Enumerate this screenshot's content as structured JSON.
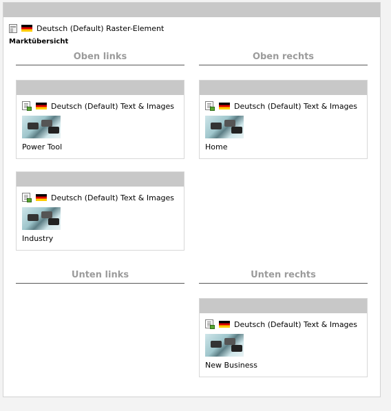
{
  "raster": {
    "language": "Deutsch (Default)",
    "label": "Deutsch (Default) Raster-Element",
    "title": "Marktübersicht"
  },
  "columns": {
    "oben_links": "Oben links",
    "oben_rechts": "Oben rechts",
    "unten_links": "Unten links",
    "unten_rechts": "Unten rechts"
  },
  "cards": [
    {
      "type_label": "Deutsch (Default) Text & Images",
      "caption": "Power Tool"
    },
    {
      "type_label": "Deutsch (Default) Text & Images",
      "caption": "Home"
    },
    {
      "type_label": "Deutsch (Default) Text & Images",
      "caption": "Industry"
    },
    {
      "type_label": "Deutsch (Default) Text & Images",
      "caption": "New Business"
    }
  ],
  "icons": {
    "grid": "grid-element-icon",
    "text_images": "text-images-icon",
    "flag": "german-flag-icon"
  }
}
